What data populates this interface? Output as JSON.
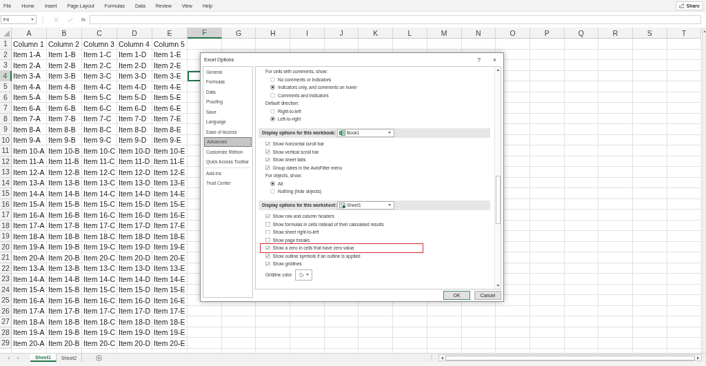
{
  "menu": [
    "File",
    "Home",
    "Insert",
    "Page Layout",
    "Formulas",
    "Data",
    "Review",
    "View",
    "Help"
  ],
  "share_button": "Share",
  "formula_bar": {
    "name_box": "F4",
    "function_label": "fx"
  },
  "sheet": {
    "columns": [
      {
        "label": "A",
        "selected": false
      },
      {
        "label": "B",
        "selected": false
      },
      {
        "label": "C",
        "selected": false
      },
      {
        "label": "D",
        "selected": false
      },
      {
        "label": "E",
        "selected": false
      },
      {
        "label": "F",
        "selected": true
      },
      {
        "label": "G",
        "selected": false
      },
      {
        "label": "H",
        "selected": false
      },
      {
        "label": "I",
        "selected": false
      },
      {
        "label": "J",
        "selected": false
      },
      {
        "label": "K",
        "selected": false
      },
      {
        "label": "L",
        "selected": false
      },
      {
        "label": "M",
        "selected": false
      },
      {
        "label": "N",
        "selected": false
      },
      {
        "label": "O",
        "selected": false
      },
      {
        "label": "P",
        "selected": false
      },
      {
        "label": "Q",
        "selected": false
      },
      {
        "label": "R",
        "selected": false
      },
      {
        "label": "S",
        "selected": false
      },
      {
        "label": "T",
        "selected": false
      }
    ],
    "rows": [
      {
        "label": "1",
        "selected": false,
        "cells": [
          "Column 1",
          "Column 2",
          "Column 3",
          "Column 4",
          "Column 5"
        ]
      },
      {
        "label": "2",
        "selected": false,
        "cells": [
          "Item 1-A",
          "Item 1-B",
          "Item 1-C",
          "Item 1-D",
          "Item 1-E"
        ]
      },
      {
        "label": "3",
        "selected": false,
        "cells": [
          "Item 2-A",
          "Item 2-B",
          "Item 2-C",
          "Item 2-D",
          "Item 2-E"
        ]
      },
      {
        "label": "4",
        "selected": true,
        "cells": [
          "Item 3-A",
          "Item 3-B",
          "Item 3-C",
          "Item 3-D",
          "Item 3-E"
        ]
      },
      {
        "label": "5",
        "selected": false,
        "cells": [
          "Item 4-A",
          "Item 4-B",
          "Item 4-C",
          "Item 4-D",
          "Item 4-E"
        ]
      },
      {
        "label": "6",
        "selected": false,
        "cells": [
          "Item 5-A",
          "Item 5-B",
          "Item 5-C",
          "Item 5-D",
          "Item 5-E"
        ]
      },
      {
        "label": "7",
        "selected": false,
        "cells": [
          "Item 6-A",
          "Item 6-B",
          "Item 6-C",
          "Item 6-D",
          "Item 6-E"
        ]
      },
      {
        "label": "8",
        "selected": false,
        "cells": [
          "Item 7-A",
          "Item 7-B",
          "Item 7-C",
          "Item 7-D",
          "Item 7-E"
        ]
      },
      {
        "label": "9",
        "selected": false,
        "cells": [
          "Item 8-A",
          "Item 8-B",
          "Item 8-C",
          "Item 8-D",
          "Item 8-E"
        ]
      },
      {
        "label": "10",
        "selected": false,
        "cells": [
          "Item 9-A",
          "Item 9-B",
          "Item 9-C",
          "Item 9-D",
          "Item 9-E"
        ]
      },
      {
        "label": "11",
        "selected": false,
        "cells": [
          "Item 10-A",
          "Item 10-B",
          "Item 10-C",
          "Item 10-D",
          "Item 10-E"
        ]
      },
      {
        "label": "12",
        "selected": false,
        "cells": [
          "Item 11-A",
          "Item 11-B",
          "Item 11-C",
          "Item 11-D",
          "Item 11-E"
        ]
      },
      {
        "label": "13",
        "selected": false,
        "cells": [
          "Item 12-A",
          "Item 12-B",
          "Item 12-C",
          "Item 12-D",
          "Item 12-E"
        ]
      },
      {
        "label": "14",
        "selected": false,
        "cells": [
          "Item 13-A",
          "Item 13-B",
          "Item 13-C",
          "Item 13-D",
          "Item 13-E"
        ]
      },
      {
        "label": "15",
        "selected": false,
        "cells": [
          "Item 14-A",
          "Item 14-B",
          "Item 14-C",
          "Item 14-D",
          "Item 14-E"
        ]
      },
      {
        "label": "16",
        "selected": false,
        "cells": [
          "Item 15-A",
          "Item 15-B",
          "Item 15-C",
          "Item 15-D",
          "Item 15-E"
        ]
      },
      {
        "label": "17",
        "selected": false,
        "cells": [
          "Item 16-A",
          "Item 16-B",
          "Item 16-C",
          "Item 16-D",
          "Item 16-E"
        ]
      },
      {
        "label": "18",
        "selected": false,
        "cells": [
          "Item 17-A",
          "Item 17-B",
          "Item 17-C",
          "Item 17-D",
          "Item 17-E"
        ]
      },
      {
        "label": "19",
        "selected": false,
        "cells": [
          "Item 18-A",
          "Item 18-B",
          "Item 18-C",
          "Item 18-D",
          "Item 18-E"
        ]
      },
      {
        "label": "20",
        "selected": false,
        "cells": [
          "Item 19-A",
          "Item 19-B",
          "Item 19-C",
          "Item 19-D",
          "Item 19-E"
        ]
      },
      {
        "label": "21",
        "selected": false,
        "cells": [
          "Item 20-A",
          "Item 20-B",
          "Item 20-C",
          "Item 20-D",
          "Item 20-E"
        ]
      },
      {
        "label": "22",
        "selected": false,
        "cells": [
          "Item 13-A",
          "Item 13-B",
          "Item 13-C",
          "Item 13-D",
          "Item 13-E"
        ]
      },
      {
        "label": "23",
        "selected": false,
        "cells": [
          "Item 14-A",
          "Item 14-B",
          "Item 14-C",
          "Item 14-D",
          "Item 14-E"
        ]
      },
      {
        "label": "24",
        "selected": false,
        "cells": [
          "Item 15-A",
          "Item 15-B",
          "Item 15-C",
          "Item 15-D",
          "Item 15-E"
        ]
      },
      {
        "label": "25",
        "selected": false,
        "cells": [
          "Item 16-A",
          "Item 16-B",
          "Item 16-C",
          "Item 16-D",
          "Item 16-E"
        ]
      },
      {
        "label": "26",
        "selected": false,
        "cells": [
          "Item 17-A",
          "Item 17-B",
          "Item 17-C",
          "Item 17-D",
          "Item 17-E"
        ]
      },
      {
        "label": "27",
        "selected": false,
        "cells": [
          "Item 18-A",
          "Item 18-B",
          "Item 18-C",
          "Item 18-D",
          "Item 18-E"
        ]
      },
      {
        "label": "28",
        "selected": false,
        "cells": [
          "Item 19-A",
          "Item 19-B",
          "Item 19-C",
          "Item 19-D",
          "Item 19-E"
        ]
      },
      {
        "label": "29",
        "selected": false,
        "cells": [
          "Item 20-A",
          "Item 20-B",
          "Item 20-C",
          "Item 20-D",
          "Item 20-E"
        ]
      }
    ]
  },
  "sheet_tabs": [
    {
      "label": "Sheet1",
      "selected": true
    },
    {
      "label": "Sheet2",
      "selected": false
    }
  ],
  "dialog": {
    "title": "Excel Options",
    "help": "?",
    "close": "×",
    "nav_groups": [
      {
        "items": [
          {
            "label": "General",
            "selected": false
          },
          {
            "label": "Formulas",
            "selected": false
          },
          {
            "label": "Data",
            "selected": false
          },
          {
            "label": "Proofing",
            "selected": false
          },
          {
            "label": "Save",
            "selected": false
          },
          {
            "label": "Language",
            "selected": false
          },
          {
            "label": "Ease of Access",
            "selected": false
          },
          {
            "label": "Advanced",
            "selected": true
          },
          {
            "label": "Customize Ribbon",
            "selected": false
          },
          {
            "label": "Quick Access Toolbar",
            "selected": false
          }
        ]
      },
      {
        "items": [
          {
            "label": "Add-ins",
            "selected": false
          },
          {
            "label": "Trust Center",
            "selected": false
          }
        ]
      }
    ],
    "content": [
      {
        "kind": "heading",
        "label": "For cells with comments, show:"
      },
      {
        "kind": "radio",
        "label": "No comments or indicators",
        "selected": false
      },
      {
        "kind": "radio",
        "label": "Indicators only, and comments on hover",
        "selected": true
      },
      {
        "kind": "radio",
        "label": "Comments and indicators",
        "selected": false
      },
      {
        "kind": "heading",
        "label": "Default direction:"
      },
      {
        "kind": "radio",
        "label": "Right-to-left",
        "selected": false
      },
      {
        "kind": "radio",
        "label": "Left-to-right",
        "selected": true
      },
      {
        "kind": "section",
        "label": "Display options for this workbook:",
        "dropdown": {
          "kind": "workbook",
          "value": "Book1"
        }
      },
      {
        "kind": "checkbox",
        "label": "Show horizontal scroll bar",
        "checked": true,
        "highlighted": false
      },
      {
        "kind": "checkbox",
        "label": "Show vertical scroll bar",
        "checked": true,
        "highlighted": false
      },
      {
        "kind": "checkbox",
        "label": "Show sheet tabs",
        "checked": true,
        "highlighted": false
      },
      {
        "kind": "checkbox",
        "label": "Group dates in the AutoFilter menu",
        "checked": true,
        "highlighted": false
      },
      {
        "kind": "heading",
        "label": "For objects, show:"
      },
      {
        "kind": "radio",
        "label": "All",
        "selected": true
      },
      {
        "kind": "radio",
        "label": "Nothing (hide objects)",
        "selected": false
      },
      {
        "kind": "section",
        "label": "Display options for this worksheet:",
        "dropdown": {
          "kind": "worksheet",
          "value": "Sheet1"
        }
      },
      {
        "kind": "checkbox",
        "label": "Show row and column headers",
        "checked": true,
        "highlighted": false
      },
      {
        "kind": "checkbox",
        "label": "Show formulas in cells instead of their calculated results",
        "checked": false,
        "highlighted": false
      },
      {
        "kind": "checkbox",
        "label": "Show sheet right-to-left",
        "checked": false,
        "highlighted": false
      },
      {
        "kind": "checkbox",
        "label": "Show page breaks",
        "checked": false,
        "highlighted": false
      },
      {
        "kind": "checkbox",
        "label": "Show a zero in cells that have zero value",
        "checked": true,
        "highlighted": true
      },
      {
        "kind": "checkbox",
        "label": "Show outline symbols if an outline is applied",
        "checked": true,
        "highlighted": false
      },
      {
        "kind": "checkbox",
        "label": "Show gridlines",
        "checked": true,
        "highlighted": false
      },
      {
        "kind": "color",
        "label": "Gridline color"
      }
    ],
    "buttons": [
      {
        "label": "OK",
        "default": true
      },
      {
        "label": "Cancel",
        "default": false
      }
    ]
  }
}
